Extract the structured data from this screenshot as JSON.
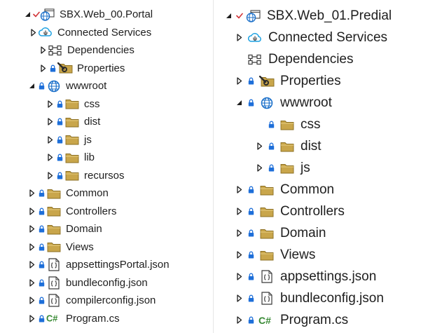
{
  "colors": {
    "folder": "#c9a64b",
    "lock": "#1e6fd9",
    "check": "#d13438",
    "globe": "#1a6fc9",
    "cloud": "#1ba1e2",
    "csharp": "#388a34",
    "text": "#1e1e1e"
  },
  "left": [
    {
      "label": "SBX.Web_00.Portal",
      "expander": "expanded",
      "check": true,
      "lock": false,
      "icon": "web-project-icon"
    },
    {
      "label": "Connected Services",
      "expander": "collapsed",
      "check": false,
      "lock": false,
      "icon": "connected-services-icon"
    },
    {
      "label": "Dependencies",
      "expander": "collapsed",
      "check": false,
      "lock": false,
      "icon": "dependencies-icon"
    },
    {
      "label": "Properties",
      "expander": "collapsed",
      "check": false,
      "lock": true,
      "icon": "properties-folder-icon"
    },
    {
      "label": "wwwroot",
      "expander": "expanded",
      "check": false,
      "lock": true,
      "icon": "globe-icon"
    },
    {
      "label": "css",
      "expander": "collapsed",
      "check": false,
      "lock": true,
      "icon": "folder-icon"
    },
    {
      "label": "dist",
      "expander": "collapsed",
      "check": false,
      "lock": true,
      "icon": "folder-icon"
    },
    {
      "label": "js",
      "expander": "collapsed",
      "check": false,
      "lock": true,
      "icon": "folder-icon"
    },
    {
      "label": "lib",
      "expander": "collapsed",
      "check": false,
      "lock": true,
      "icon": "folder-icon"
    },
    {
      "label": "recursos",
      "expander": "collapsed",
      "check": false,
      "lock": true,
      "icon": "folder-icon"
    },
    {
      "label": "Common",
      "expander": "collapsed",
      "check": false,
      "lock": true,
      "icon": "folder-icon"
    },
    {
      "label": "Controllers",
      "expander": "collapsed",
      "check": false,
      "lock": true,
      "icon": "folder-icon"
    },
    {
      "label": "Domain",
      "expander": "collapsed",
      "check": false,
      "lock": true,
      "icon": "folder-icon"
    },
    {
      "label": "Views",
      "expander": "collapsed",
      "check": false,
      "lock": true,
      "icon": "folder-icon"
    },
    {
      "label": "appsettingsPortal.json",
      "expander": "collapsed",
      "check": false,
      "lock": true,
      "icon": "json-file-icon"
    },
    {
      "label": "bundleconfig.json",
      "expander": "collapsed",
      "check": false,
      "lock": true,
      "icon": "json-file-icon"
    },
    {
      "label": "compilerconfig.json",
      "expander": "collapsed",
      "check": false,
      "lock": true,
      "icon": "json-file-icon"
    },
    {
      "label": "Program.cs",
      "expander": "collapsed",
      "check": false,
      "lock": true,
      "icon": "csharp-file-icon"
    }
  ],
  "right": [
    {
      "label": "SBX.Web_01.Predial",
      "expander": "expanded",
      "check": true,
      "lock": false,
      "icon": "web-project-icon"
    },
    {
      "label": "Connected Services",
      "expander": "collapsed",
      "check": false,
      "lock": false,
      "icon": "connected-services-icon"
    },
    {
      "label": "Dependencies",
      "expander": "none",
      "check": false,
      "lock": false,
      "icon": "dependencies-icon"
    },
    {
      "label": "Properties",
      "expander": "collapsed",
      "check": false,
      "lock": true,
      "icon": "properties-folder-icon"
    },
    {
      "label": "wwwroot",
      "expander": "expanded",
      "check": false,
      "lock": true,
      "icon": "globe-icon"
    },
    {
      "label": "css",
      "expander": "none",
      "check": false,
      "lock": true,
      "icon": "folder-icon"
    },
    {
      "label": "dist",
      "expander": "collapsed",
      "check": false,
      "lock": true,
      "icon": "folder-icon"
    },
    {
      "label": "js",
      "expander": "collapsed",
      "check": false,
      "lock": true,
      "icon": "folder-icon"
    },
    {
      "label": "Common",
      "expander": "collapsed",
      "check": false,
      "lock": true,
      "icon": "folder-icon"
    },
    {
      "label": "Controllers",
      "expander": "collapsed",
      "check": false,
      "lock": true,
      "icon": "folder-icon"
    },
    {
      "label": "Domain",
      "expander": "collapsed",
      "check": false,
      "lock": true,
      "icon": "folder-icon"
    },
    {
      "label": "Views",
      "expander": "collapsed",
      "check": false,
      "lock": true,
      "icon": "folder-icon"
    },
    {
      "label": "appsettings.json",
      "expander": "collapsed",
      "check": false,
      "lock": true,
      "icon": "json-file-icon"
    },
    {
      "label": "bundleconfig.json",
      "expander": "collapsed",
      "check": false,
      "lock": true,
      "icon": "json-file-icon"
    },
    {
      "label": "Program.cs",
      "expander": "collapsed",
      "check": false,
      "lock": true,
      "icon": "csharp-file-icon"
    }
  ]
}
